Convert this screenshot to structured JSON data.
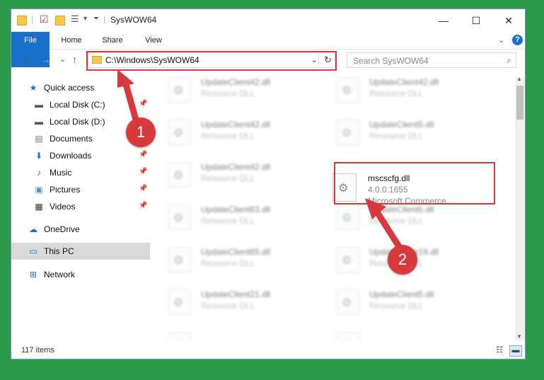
{
  "window": {
    "title": "SysWOW64",
    "controls": {
      "minimize": "—",
      "maximize": "☐",
      "close": "✕"
    }
  },
  "ribbon": {
    "tabs": [
      "File",
      "Home",
      "Share",
      "View"
    ],
    "expand_icon": "chevron-down-icon",
    "help_icon": "help-icon"
  },
  "navigation": {
    "back": "←",
    "forward": "→",
    "recent": "⌄",
    "up": "↑",
    "address": "C:\\Windows\\SysWOW64",
    "search_placeholder": "Search SysWOW64"
  },
  "sidebar": {
    "items": [
      {
        "label": "Quick access",
        "icon": "star-icon",
        "pinned": false
      },
      {
        "label": "Local Disk (C:)",
        "icon": "disk-icon",
        "pinned": true
      },
      {
        "label": "Local Disk (D:)",
        "icon": "disk-icon",
        "pinned": false
      },
      {
        "label": "Documents",
        "icon": "documents-icon",
        "pinned": true
      },
      {
        "label": "Downloads",
        "icon": "downloads-icon",
        "pinned": true
      },
      {
        "label": "Music",
        "icon": "music-icon",
        "pinned": true
      },
      {
        "label": "Pictures",
        "icon": "pictures-icon",
        "pinned": true
      },
      {
        "label": "Videos",
        "icon": "videos-icon",
        "pinned": true
      },
      {
        "label": "OneDrive",
        "icon": "cloud-icon",
        "pinned": false
      },
      {
        "label": "This PC",
        "icon": "pc-icon",
        "pinned": false,
        "selected": true
      },
      {
        "label": "Network",
        "icon": "network-icon",
        "pinned": false
      }
    ]
  },
  "files": {
    "left": [
      {
        "name": "UpdateClient42.dll",
        "desc": "Resource DLL"
      },
      {
        "name": "UpdateClient42.dll",
        "desc": "Resource DLL"
      },
      {
        "name": "UpdateClient42.dll",
        "desc": "Resource DLL"
      },
      {
        "name": "UpdateClient63.dll",
        "desc": "Resource DLL"
      },
      {
        "name": "UpdateClient65.dll",
        "desc": "Resource DLL"
      },
      {
        "name": "UpdateClient21.dll",
        "desc": "Resource DLL"
      }
    ],
    "right": [
      {
        "name": "UpdateClient42.dll",
        "desc": "Resource DLL"
      },
      {
        "name": "UpdateClient5.dll",
        "desc": "Resource DLL"
      },
      {
        "name": "UpdateClient5.dll",
        "desc": "Resource DLL"
      },
      {
        "name": "UpdateClient19.dll",
        "desc": "Resource DLL"
      },
      {
        "name": "UpdateClient5.dll",
        "desc": "Resource DLL"
      }
    ],
    "highlighted": {
      "name": "mscscfg.dll",
      "version": "4.0.0.1655",
      "company": "Microsoft Commerce ..."
    }
  },
  "status": {
    "count": "117 items"
  },
  "annotations": {
    "step1": "1",
    "step2": "2",
    "color": "#d7393c"
  }
}
